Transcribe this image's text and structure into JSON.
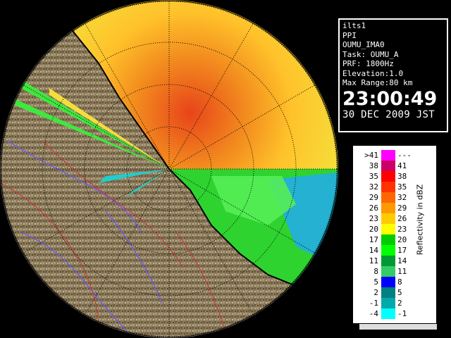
{
  "radar": {
    "site": "ilts1",
    "scan_type": "PPI",
    "product": "OUMU_IMA0",
    "task": "Task: OUMU_A",
    "prf": "PRF: 1800Hz",
    "elevation": "Elevation:1.0",
    "max_range": "Max Range:80 km",
    "time": "23:00:49",
    "date": "30 DEC 2009 JST"
  },
  "legend": {
    "title": "Reflectivity in dBZ",
    "rows": [
      {
        "lo": ">41",
        "hi": "---",
        "color": "#ff00ff"
      },
      {
        "lo": "38",
        "hi": "41",
        "color": "#cc0066"
      },
      {
        "lo": "35",
        "hi": "38",
        "color": "#ff0000"
      },
      {
        "lo": "32",
        "hi": "35",
        "color": "#ff3300"
      },
      {
        "lo": "29",
        "hi": "32",
        "color": "#ff6600"
      },
      {
        "lo": "26",
        "hi": "29",
        "color": "#ff9900"
      },
      {
        "lo": "23",
        "hi": "26",
        "color": "#ffcc00"
      },
      {
        "lo": "20",
        "hi": "23",
        "color": "#ffff00"
      },
      {
        "lo": "17",
        "hi": "20",
        "color": "#00cc00"
      },
      {
        "lo": "14",
        "hi": "17",
        "color": "#00ff00"
      },
      {
        "lo": "11",
        "hi": "14",
        "color": "#009933"
      },
      {
        "lo": "8",
        "hi": "11",
        "color": "#33cc66"
      },
      {
        "lo": "5",
        "hi": "8",
        "color": "#0000ff"
      },
      {
        "lo": "2",
        "hi": "5",
        "color": "#008080"
      },
      {
        "lo": "-1",
        "hi": "2",
        "color": "#00aaaa"
      },
      {
        "lo": "-4",
        "hi": "-1",
        "color": "#00ffff"
      }
    ]
  },
  "colors": {
    "background": "#000000",
    "sea": "#1a3fd0",
    "land": "#8a7a5a",
    "echo_strong": "#e8641a",
    "echo_moderate": "#ffb020",
    "echo_weak": "#f5e23a",
    "echo_light": "#33dd33",
    "clear_air": "#22aaee",
    "range_rings": "#000000",
    "coastline": "#000000",
    "rivers": "#6655ff",
    "boundaries": "#cc3333"
  }
}
